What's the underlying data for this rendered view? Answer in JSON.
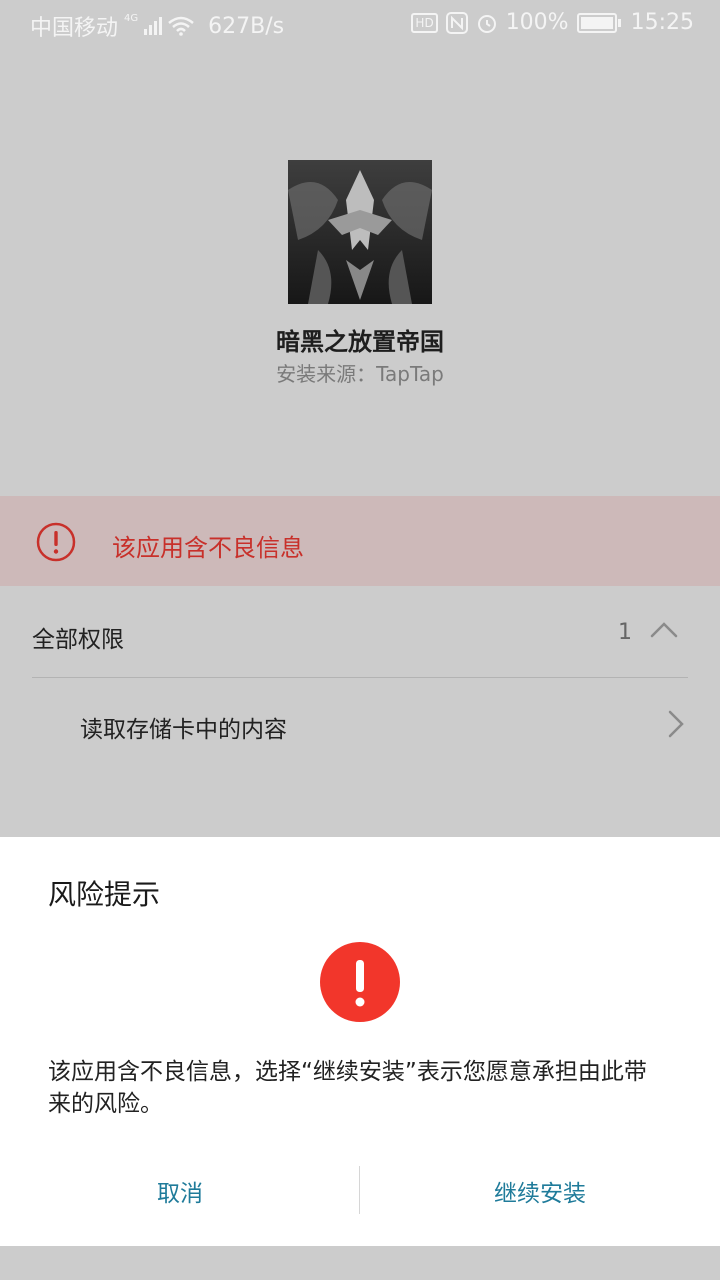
{
  "status_bar": {
    "carrier": "中国移动",
    "network_tag": "4G",
    "speed": "627B/s",
    "hd_label": "HD",
    "battery_percent": "100%",
    "time": "15:25"
  },
  "app": {
    "name": "暗黑之放置帝国",
    "source": "安装来源：TapTap"
  },
  "warning": {
    "text": "该应用含不良信息",
    "color": "#c8302a"
  },
  "permissions": {
    "title": "全部权限",
    "count": "1",
    "items": [
      {
        "label": "读取存储卡中的内容"
      }
    ]
  },
  "dialog": {
    "title": "风险提示",
    "message": "该应用含不良信息，选择“继续安装”表示您愿意承担由此带来的风险。",
    "cancel_label": "取消",
    "continue_label": "继续安装",
    "icon_color": "#f2362b",
    "button_color": "#1f7b9a"
  },
  "icons": {
    "warning": "exclamation-circle-icon",
    "dialog_warning": "alert-filled-icon",
    "expand": "chevron-up-icon",
    "navigate": "chevron-right-icon"
  }
}
